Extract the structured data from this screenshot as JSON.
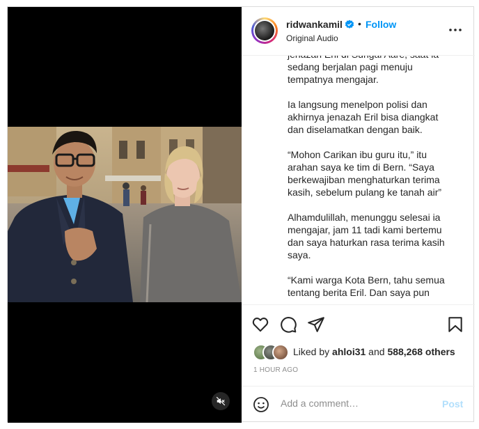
{
  "post": {
    "username": "ridwankamil",
    "verified_icon": "verified-badge-icon",
    "separator": "•",
    "follow_label": "Follow",
    "audio_label": "Original Audio"
  },
  "caption": {
    "paragraphs": [
      "jenazah Eril di Sungai Aare, saat ia sedang berjalan pagi menuju tempatnya mengajar.",
      "Ia langsung menelpon polisi dan akhirnya jenazah Eril bisa diangkat dan diselamatkan dengan baik.",
      "“Mohon Carikan ibu guru itu,” itu arahan saya ke tim di Bern. “Saya berkewajiban menghaturkan terima kasih, sebelum pulang ke tanah air”",
      "Alhamdulillah, menunggu selesai ia mengajar, jam 11 tadi kami bertemu dan saya haturkan rasa terima kasih saya.",
      "“Kami warga Kota Bern, tahu semua tentang berita Eril. Dan saya pun"
    ]
  },
  "likes": {
    "prefix": "Liked by ",
    "user": "ahloi31",
    "conjunction": " and ",
    "others": "588,268 others"
  },
  "timestamp": "1 HOUR AGO",
  "comment": {
    "placeholder": "Add a comment…",
    "post_label": "Post"
  },
  "icons": {
    "like": "heart-icon",
    "comment": "comment-icon",
    "share": "share-icon",
    "save": "bookmark-icon",
    "more": "more-options-icon",
    "emoji": "emoji-icon",
    "mute": "muted-audio-icon"
  },
  "colors": {
    "accent": "#0095f6",
    "post_disabled": "#b2dffc",
    "muted_text": "#8e8e8e"
  }
}
